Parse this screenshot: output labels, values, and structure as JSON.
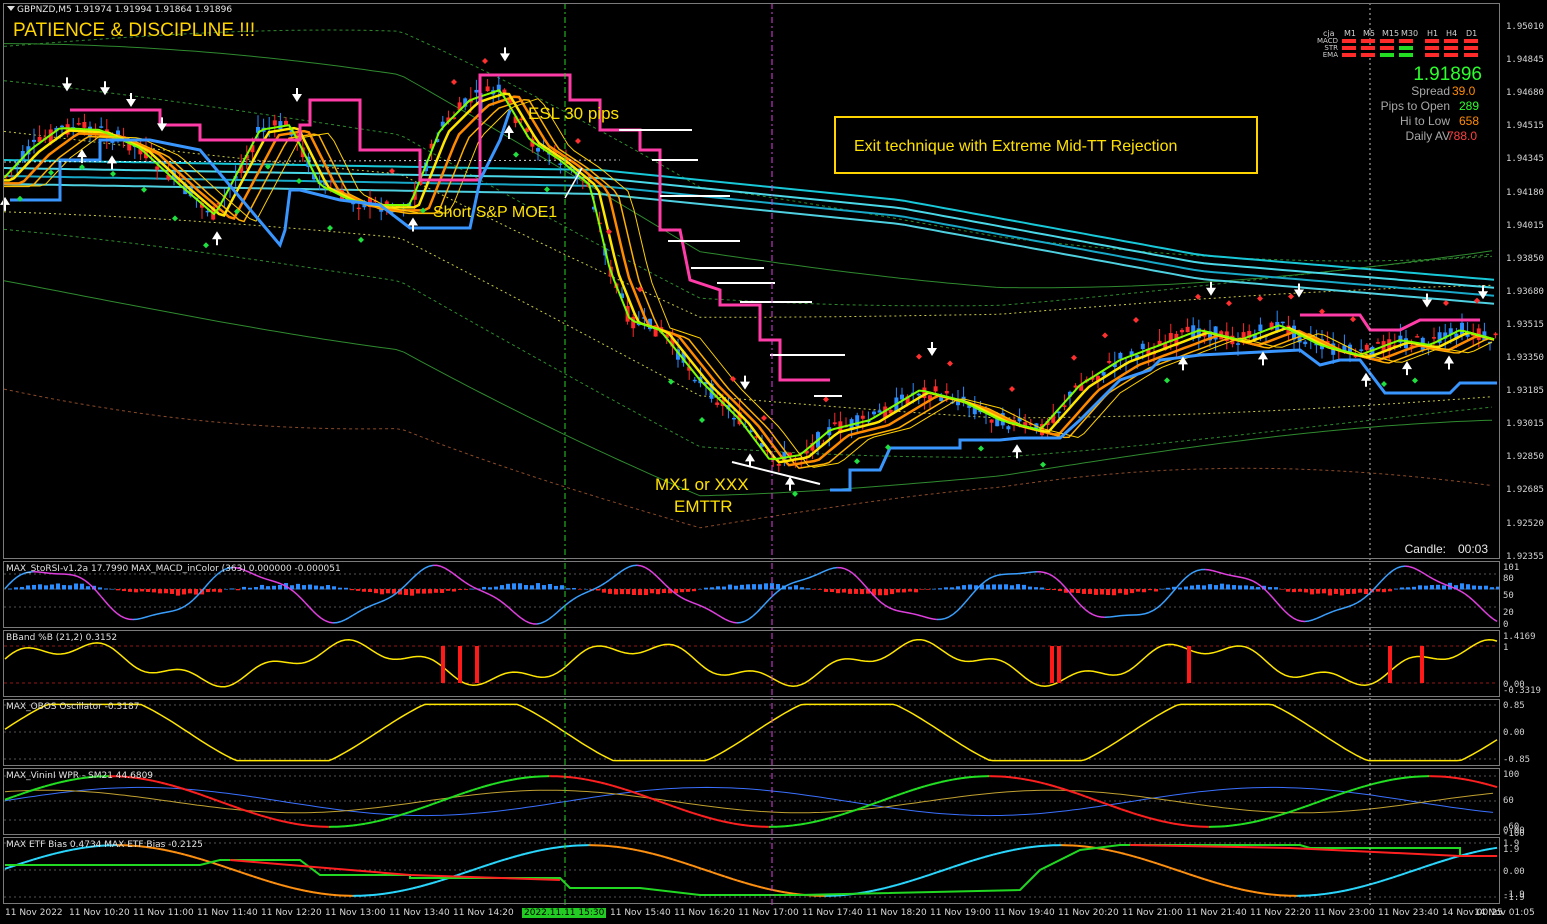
{
  "header": {
    "symbol_line": "GBPNZD,M5  1.91974 1.91994 1.91864 1.91896",
    "title": "PATIENCE & DISCIPLINE !!!"
  },
  "annotations": {
    "esl": "ESL 30 pips",
    "short": "Short S&P MOE1",
    "mx1_line1": "MX1 or XXX",
    "mx1_line2": "EMTTR",
    "exit_box": "Exit technique with Extreme Mid-TT Rejection"
  },
  "dashboard": {
    "timeframes": [
      "cja",
      "M1",
      "M5",
      "M15",
      "M30",
      "H1",
      "H4",
      "D1"
    ],
    "rows": [
      {
        "label": "MACD",
        "colors": [
          "red",
          "red",
          "red",
          "red",
          "red",
          "red",
          "red"
        ]
      },
      {
        "label": "STR",
        "colors": [
          "red",
          "red",
          "red",
          "green",
          "red",
          "red",
          "red"
        ]
      },
      {
        "label": "EMA",
        "colors": [
          "red",
          "red",
          "green",
          "green",
          "red",
          "red",
          "red"
        ]
      }
    ],
    "price": "1.91896",
    "spread_label": "Spread",
    "spread_value": "39.0",
    "pips_open_label": "Pips to Open",
    "pips_open_value": "289",
    "hi_low_label": "Hi to Low",
    "hi_low_value": "658",
    "daily_label": "Daily AV",
    "daily_value": "788.0",
    "candle_label": "Candle:",
    "candle_value": "00:03",
    "colors": {
      "red": "#ff2a2a",
      "green": "#22dd22",
      "price": "#2cff2c"
    }
  },
  "price_scale": [
    "1.95010",
    "1.94845",
    "1.94680",
    "1.94515",
    "1.94345",
    "1.94180",
    "1.94015",
    "1.93850",
    "1.93680",
    "1.93515",
    "1.93350",
    "1.93185",
    "1.93015",
    "1.92850",
    "1.92685",
    "1.92520",
    "1.92355"
  ],
  "subpanes": [
    {
      "label": "MAX_StoRSI-v1.2a 17.7990  MAX_MACD_inColor (363) 0.000000 -0.000051",
      "scale": [
        "101",
        "80",
        "50",
        "20",
        "0"
      ]
    },
    {
      "label": "BBand %B (21,2) 0.3152",
      "scale": [
        "1.4169",
        "1",
        "0.00",
        "-0.3319"
      ]
    },
    {
      "label": "MAX_OBOS Oscillator -0.3187",
      "scale": [
        "0.85",
        "0.00",
        "-0.85"
      ]
    },
    {
      "label": "MAX_VininI WPR - SM21 44.6809",
      "scale": [
        "100",
        "60",
        "0.00",
        "-60",
        "-100"
      ]
    },
    {
      "label": "MAX ETF Bias 0.4734  MAX ETF Bias -0.2125",
      "scale": [
        "1.9",
        "1.9",
        "0.00",
        "-1.9",
        "-1.9"
      ]
    }
  ],
  "time_axis": [
    "11 Nov 2022",
    "11 Nov 10:20",
    "11 Nov 11:00",
    "11 Nov 11:40",
    "11 Nov 12:20",
    "11 Nov 13:00",
    "11 Nov 13:40",
    "11 Nov 14:20",
    "2022.11.11 15:30",
    "11 Nov 15:40",
    "11 Nov 16:20",
    "11 Nov 17:00",
    "11 Nov 17:40",
    "11 Nov 18:20",
    "11 Nov 19:00",
    "11 Nov 19:40",
    "11 Nov 20:20",
    "11 Nov 21:00",
    "11 Nov 21:40",
    "11 Nov 22:20",
    "11 Nov 23:00",
    "11 Nov 23:40",
    "14 Nov 00:25",
    "14 Nov 01:05"
  ]
}
